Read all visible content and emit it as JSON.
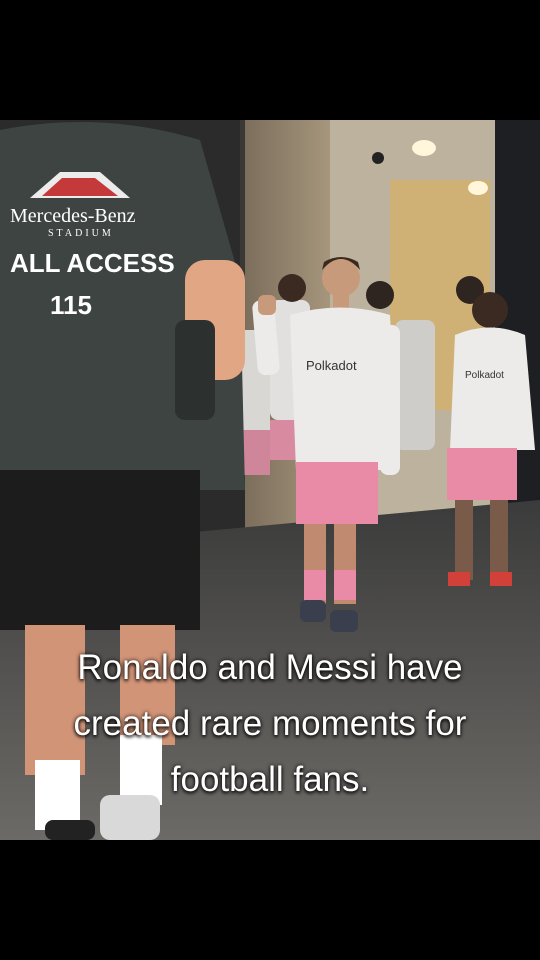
{
  "caption": {
    "line1": "Ronaldo and Messi have",
    "line2": "created rare moments for",
    "line3": "football fans."
  },
  "vest": {
    "brand": "Mercedes-Benz",
    "sub": "STADIUM",
    "access": "ALL ACCESS",
    "number": "115"
  },
  "shirt_sponsor": "Polkadot",
  "colors": {
    "shirt_pink": "#e98aa6",
    "jersey_white": "#ecebea",
    "vest_grey": "#3d4442"
  }
}
